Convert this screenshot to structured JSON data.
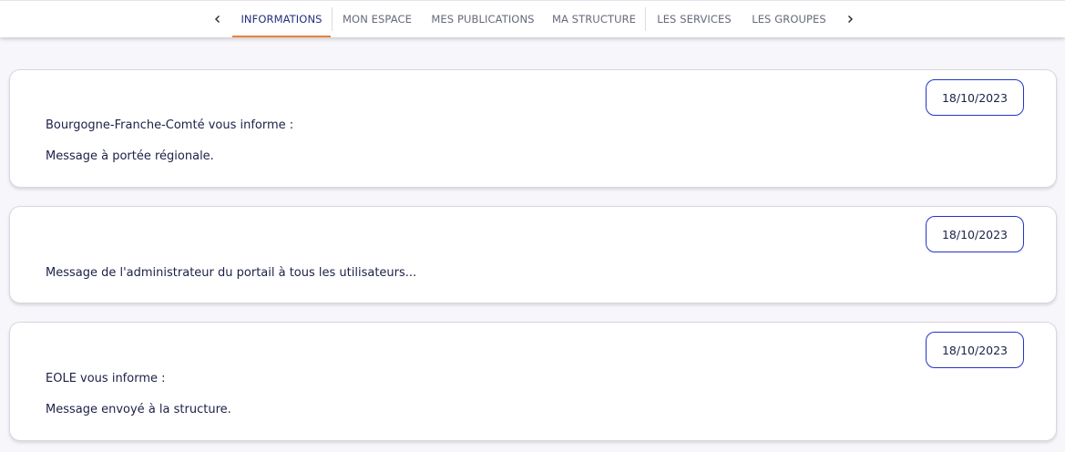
{
  "tabs": {
    "prev_icon": "chevron-left-icon",
    "next_icon": "chevron-right-icon",
    "items": [
      {
        "label": "INFORMATIONS",
        "active": true
      },
      {
        "label": "MON ESPACE"
      },
      {
        "label": "MES PUBLICATIONS"
      },
      {
        "label": "MA STRUCTURE"
      },
      {
        "label": "LES SERVICES"
      },
      {
        "label": "LES GROUPES"
      }
    ]
  },
  "colors": {
    "active_tab_text": "#23307a",
    "active_tab_underline": "#e8823a",
    "date_border": "#2433c9"
  },
  "messages": [
    {
      "date": "18/10/2023",
      "heading": "Bourgogne-Franche-Comté vous informe :",
      "body": "Message à portée régionale."
    },
    {
      "date": "18/10/2023",
      "heading": "",
      "body": "Message de l'administrateur du portail à tous les utilisateurs..."
    },
    {
      "date": "18/10/2023",
      "heading": "EOLE vous informe :",
      "body": "Message envoyé à la structure."
    }
  ]
}
